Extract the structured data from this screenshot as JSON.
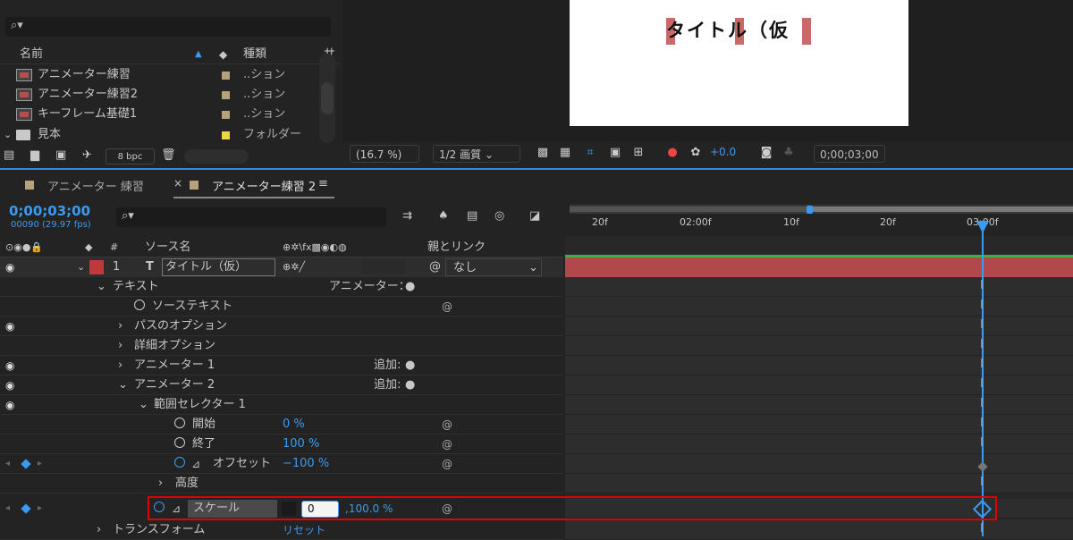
{
  "project": {
    "search_icon": "search-icon",
    "columns": {
      "name": "名前",
      "type": "種類",
      "extra": "サ"
    },
    "items": [
      {
        "label": "アニメーター練習",
        "type": "..ション",
        "swatch": "#b5a27d",
        "kind": "composition"
      },
      {
        "label": "アニメーター練習2",
        "type": "..ション",
        "swatch": "#b5a27d",
        "kind": "composition"
      },
      {
        "label": "キーフレーム基礎1",
        "type": "..ション",
        "swatch": "#b5a27d",
        "kind": "composition"
      },
      {
        "label": "見本",
        "type": "フォルダー",
        "swatch": "#e8d84a",
        "kind": "folder"
      }
    ],
    "bpc": "8 bpc"
  },
  "viewer": {
    "title_text": "タイトル（仮",
    "zoom": "(16.7 %)",
    "quality": "1/2 画質",
    "exposure": "+0.0",
    "timecode": "0;00;03;00"
  },
  "tabs": [
    {
      "label": "アニメーター 練習",
      "active": false
    },
    {
      "label": "アニメーター練習 2",
      "active": true
    }
  ],
  "timeline": {
    "timecode": "0;00;03;00",
    "fps": "00090 (29.97 fps)",
    "col_source": "ソース名",
    "col_parent": "親とリンク",
    "layer": {
      "index": "1",
      "name": "タイトル（仮）",
      "parent": "なし",
      "color": "#c0393b"
    },
    "ruler": [
      "20f",
      "02:00f",
      "10f",
      "20f",
      "03:00f"
    ],
    "rows": {
      "text": "テキスト",
      "animator_label": "アニメーター：",
      "source_text": "ソーステキスト",
      "path_options": "パスのオプション",
      "more_options": "詳細オプション",
      "animator1": "アニメーター 1",
      "animator2": "アニメーター 2",
      "add": "追加:",
      "range_selector": "範囲セレクター 1",
      "start": "開始",
      "start_val": "0 %",
      "end": "終了",
      "end_val": "100 %",
      "offset": "オフセット",
      "offset_val": "−100 %",
      "advanced": "高度",
      "scale": "スケール",
      "scale_input": "0",
      "scale_val": ",100.0 %",
      "transform": "トランスフォーム",
      "reset": "リセット"
    }
  },
  "colors": {
    "accent": "#3c9bf0",
    "highlight": "#e00000",
    "layer_bar": "#b1484c"
  }
}
